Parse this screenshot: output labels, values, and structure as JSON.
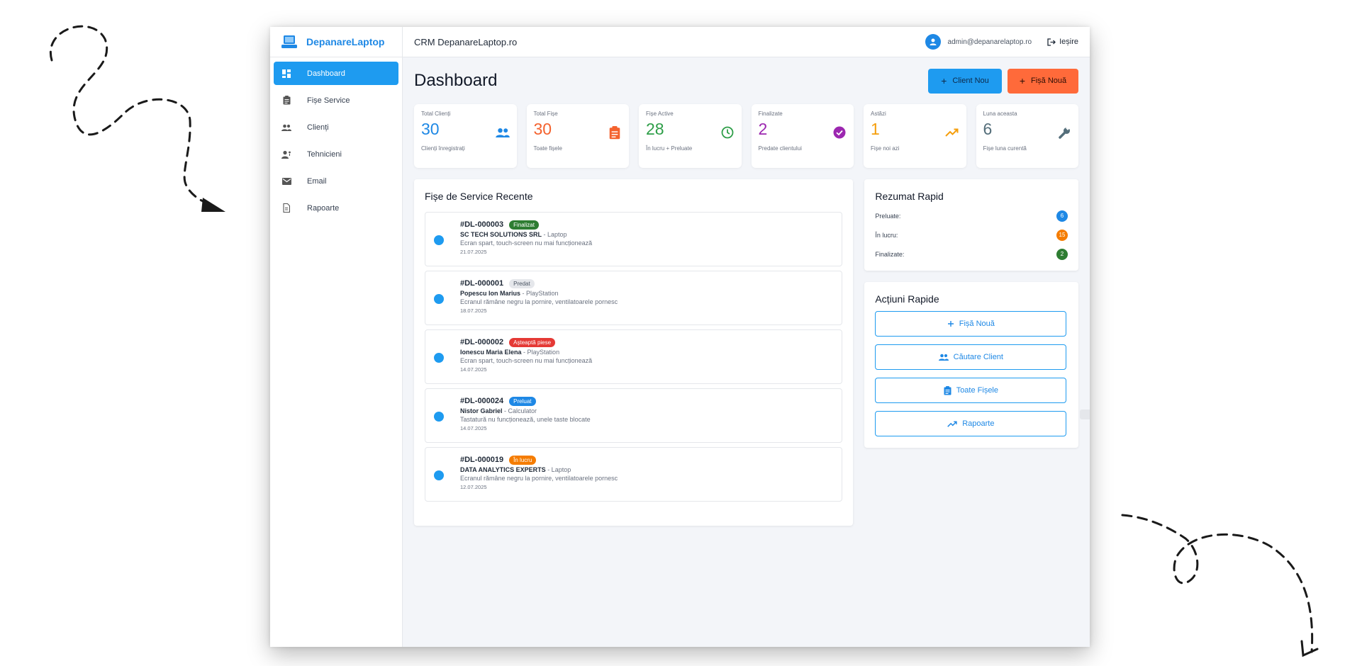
{
  "sidebar": {
    "brand": "DepanareLaptop",
    "items": [
      {
        "label": "Dashboard",
        "icon": "dashboard-icon",
        "active": true
      },
      {
        "label": "Fișe Service",
        "icon": "clipboard-icon",
        "active": false
      },
      {
        "label": "Clienți",
        "icon": "people-icon",
        "active": false
      },
      {
        "label": "Tehnicieni",
        "icon": "technician-icon",
        "active": false
      },
      {
        "label": "Email",
        "icon": "mail-icon",
        "active": false
      },
      {
        "label": "Rapoarte",
        "icon": "report-icon",
        "active": false
      }
    ]
  },
  "topbar": {
    "title": "CRM DepanareLaptop.ro",
    "user_email": "admin@depanarelaptop.ro",
    "logout_label": "Ieșire"
  },
  "page": {
    "title": "Dashboard",
    "new_client_label": "Client Nou",
    "new_sheet_label": "Fișă Nouă"
  },
  "stats": [
    {
      "label": "Total Clienți",
      "value": "30",
      "sub": "Clienți înregistrați",
      "color": "#1e88e5",
      "icon": "people-icon"
    },
    {
      "label": "Total Fișe",
      "value": "30",
      "sub": "Toate fișele",
      "color": "#f4622e",
      "icon": "clipboard-icon"
    },
    {
      "label": "Fișe Active",
      "value": "28",
      "sub": "În lucru + Preluate",
      "color": "#2e9e48",
      "icon": "clock-icon"
    },
    {
      "label": "Finalizate",
      "value": "2",
      "sub": "Predate clientului",
      "color": "#9c27b0",
      "icon": "check-circle-icon"
    },
    {
      "label": "Astăzi",
      "value": "1",
      "sub": "Fișe noi azi",
      "color": "#f59e0b",
      "icon": "trending-up-icon"
    },
    {
      "label": "Luna aceasta",
      "value": "6",
      "sub": "Fișe luna curentă",
      "color": "#546e7a",
      "icon": "wrench-icon"
    }
  ],
  "recent": {
    "title": "Fișe de Service Recente",
    "tickets": [
      {
        "id": "#DL-000003",
        "status": "Finalizat",
        "status_color": "#2e7d32",
        "client": "SC TECH SOLUTIONS SRL",
        "device": " - Laptop",
        "issue": "Ecran spart, touch-screen nu mai funcționează",
        "date": "21.07.2025"
      },
      {
        "id": "#DL-000001",
        "status": "Predat",
        "status_color": "#e5e7eb",
        "client": "Popescu Ion Marius",
        "device": " - PlayStation",
        "issue": "Ecranul rămâne negru la pornire, ventilatoarele pornesc",
        "date": "18.07.2025"
      },
      {
        "id": "#DL-000002",
        "status": "Așteaptă piese",
        "status_color": "#e53935",
        "client": "Ionescu Maria Elena",
        "device": " - PlayStation",
        "issue": "Ecran spart, touch-screen nu mai funcționează",
        "date": "14.07.2025"
      },
      {
        "id": "#DL-000024",
        "status": "Preluat",
        "status_color": "#1e88e5",
        "client": "Nistor Gabriel",
        "device": " - Calculator",
        "issue": "Tastatură nu funcționează, unele taste blocate",
        "date": "14.07.2025"
      },
      {
        "id": "#DL-000019",
        "status": "În lucru",
        "status_color": "#f57c00",
        "client": "DATA ANALYTICS EXPERTS",
        "device": " - Laptop",
        "issue": "Ecranul rămâne negru la pornire, ventilatoarele pornesc",
        "date": "12.07.2025"
      }
    ]
  },
  "summary": {
    "title": "Rezumat Rapid",
    "rows": [
      {
        "label": "Preluate:",
        "count": "6",
        "color": "#1e88e5"
      },
      {
        "label": "În lucru:",
        "count": "15",
        "color": "#f57c00"
      },
      {
        "label": "Finalizate:",
        "count": "2",
        "color": "#2e7d32"
      }
    ]
  },
  "quick_actions": {
    "title": "Acțiuni Rapide",
    "buttons": [
      {
        "label": "Fișă Nouă",
        "icon": "plus-icon"
      },
      {
        "label": "Căutare Client",
        "icon": "people-icon"
      },
      {
        "label": "Toate Fișele",
        "icon": "clipboard-icon"
      },
      {
        "label": "Rapoarte",
        "icon": "trending-up-icon"
      }
    ]
  }
}
